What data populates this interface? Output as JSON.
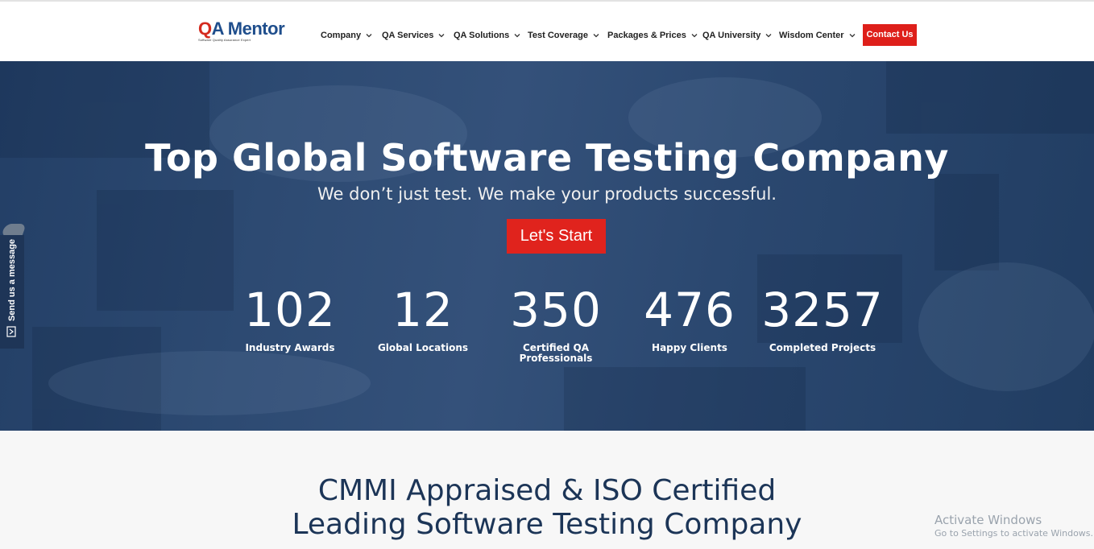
{
  "header": {
    "logo": {
      "text_q": "Q",
      "text_rest": "A Mentor",
      "tagline": "Software Quality Assurance Expert"
    },
    "nav": [
      {
        "label": "Company"
      },
      {
        "label": "QA Services"
      },
      {
        "label": "QA Solutions"
      },
      {
        "label": "Test Coverage"
      },
      {
        "label": "Packages & Prices"
      },
      {
        "label": "QA University"
      },
      {
        "label": "Wisdom Center"
      }
    ],
    "contact_label": "Contact Us"
  },
  "hero": {
    "title": "Top Global Software Testing Company",
    "subtitle": "We don’t just test. We make your products successful.",
    "cta_label": "Let's Start",
    "stats": [
      {
        "value": "102",
        "label": "Industry Awards"
      },
      {
        "value": "12",
        "label": "Global Locations"
      },
      {
        "value": "350",
        "label_line1": "Certified QA",
        "label_line2": "Professionals"
      },
      {
        "value": "476",
        "label": "Happy Clients"
      },
      {
        "value": "3257",
        "label": "Completed Projects"
      }
    ]
  },
  "side_tab": {
    "label": "Send us a message",
    "icon": "message-icon"
  },
  "section2": {
    "line1": "CMMI Appraised & ISO Certified",
    "line2": "Leading Software Testing Company"
  },
  "watermark": {
    "title": "Activate Windows",
    "subtitle": "Go to Settings to activate Windows."
  },
  "colors": {
    "brand_red": "#de1f1a",
    "hero_blue": "#2b4870",
    "heading_navy": "#1c3557"
  }
}
